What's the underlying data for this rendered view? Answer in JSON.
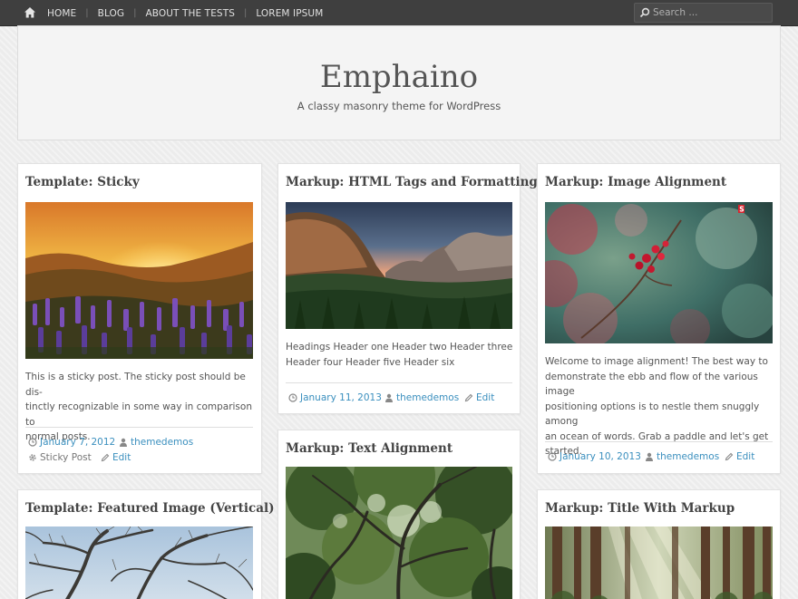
{
  "nav": {
    "home_icon": "home-icon",
    "items": [
      "HOME",
      "BLOG",
      "ABOUT THE TESTS",
      "LOREM IPSUM"
    ],
    "search_placeholder": "Search ..."
  },
  "site": {
    "title": "Emphaino",
    "tagline": "A classy masonry theme for WordPress"
  },
  "posts": [
    {
      "title": "Template: Sticky",
      "image": "sunset-wildflower-field",
      "excerpt_lines": [
        "This is a sticky post. The sticky post should be dis-",
        "tinctly recognizable in some way in comparison to",
        "normal posts."
      ],
      "date": "January 7, 2012",
      "author": "themedemos",
      "sticky_label": "Sticky Post",
      "edit": "Edit"
    },
    {
      "title": "Markup: HTML Tags and Formatting",
      "image": "yosemite-valley",
      "excerpt_lines": [
        "Headings Header one Header two Header three",
        "Header four Header five Header six"
      ],
      "date": "January 11, 2013",
      "author": "themedemos",
      "edit": "Edit"
    },
    {
      "title": "Markup: Image Alignment",
      "image": "red-berries-branch",
      "image_badge": "S",
      "excerpt_lines": [
        "Welcome to image alignment! The best way to",
        "demonstrate the ebb and flow of the various image",
        "positioning options is to nestle them snuggly among",
        "an ocean of words. Grab a paddle and let's get",
        "started."
      ],
      "date": "January 10, 2013",
      "author": "themedemos",
      "edit": "Edit"
    },
    {
      "title": "Template: Featured Image (Vertical)",
      "image": "bare-tree-sky"
    },
    {
      "title": "Markup: Text Alignment",
      "image": "forest-canopy"
    },
    {
      "title": "Markup: Title With Markup",
      "image": "sunlit-forest"
    }
  ],
  "colors": {
    "topbar": "#3f3f3f",
    "link": "#3a8fbe",
    "title": "#444444"
  }
}
